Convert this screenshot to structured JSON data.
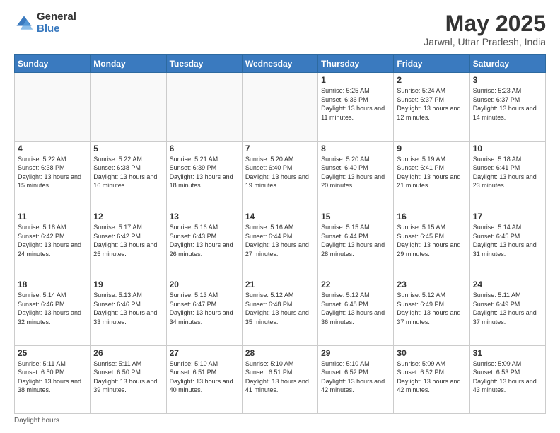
{
  "logo": {
    "general": "General",
    "blue": "Blue"
  },
  "title": "May 2025",
  "location": "Jarwal, Uttar Pradesh, India",
  "days_of_week": [
    "Sunday",
    "Monday",
    "Tuesday",
    "Wednesday",
    "Thursday",
    "Friday",
    "Saturday"
  ],
  "weeks": [
    [
      {
        "day": "",
        "info": ""
      },
      {
        "day": "",
        "info": ""
      },
      {
        "day": "",
        "info": ""
      },
      {
        "day": "",
        "info": ""
      },
      {
        "day": "1",
        "info": "Sunrise: 5:25 AM\nSunset: 6:36 PM\nDaylight: 13 hours and 11 minutes."
      },
      {
        "day": "2",
        "info": "Sunrise: 5:24 AM\nSunset: 6:37 PM\nDaylight: 13 hours and 12 minutes."
      },
      {
        "day": "3",
        "info": "Sunrise: 5:23 AM\nSunset: 6:37 PM\nDaylight: 13 hours and 14 minutes."
      }
    ],
    [
      {
        "day": "4",
        "info": "Sunrise: 5:22 AM\nSunset: 6:38 PM\nDaylight: 13 hours and 15 minutes."
      },
      {
        "day": "5",
        "info": "Sunrise: 5:22 AM\nSunset: 6:38 PM\nDaylight: 13 hours and 16 minutes."
      },
      {
        "day": "6",
        "info": "Sunrise: 5:21 AM\nSunset: 6:39 PM\nDaylight: 13 hours and 18 minutes."
      },
      {
        "day": "7",
        "info": "Sunrise: 5:20 AM\nSunset: 6:40 PM\nDaylight: 13 hours and 19 minutes."
      },
      {
        "day": "8",
        "info": "Sunrise: 5:20 AM\nSunset: 6:40 PM\nDaylight: 13 hours and 20 minutes."
      },
      {
        "day": "9",
        "info": "Sunrise: 5:19 AM\nSunset: 6:41 PM\nDaylight: 13 hours and 21 minutes."
      },
      {
        "day": "10",
        "info": "Sunrise: 5:18 AM\nSunset: 6:41 PM\nDaylight: 13 hours and 23 minutes."
      }
    ],
    [
      {
        "day": "11",
        "info": "Sunrise: 5:18 AM\nSunset: 6:42 PM\nDaylight: 13 hours and 24 minutes."
      },
      {
        "day": "12",
        "info": "Sunrise: 5:17 AM\nSunset: 6:42 PM\nDaylight: 13 hours and 25 minutes."
      },
      {
        "day": "13",
        "info": "Sunrise: 5:16 AM\nSunset: 6:43 PM\nDaylight: 13 hours and 26 minutes."
      },
      {
        "day": "14",
        "info": "Sunrise: 5:16 AM\nSunset: 6:44 PM\nDaylight: 13 hours and 27 minutes."
      },
      {
        "day": "15",
        "info": "Sunrise: 5:15 AM\nSunset: 6:44 PM\nDaylight: 13 hours and 28 minutes."
      },
      {
        "day": "16",
        "info": "Sunrise: 5:15 AM\nSunset: 6:45 PM\nDaylight: 13 hours and 29 minutes."
      },
      {
        "day": "17",
        "info": "Sunrise: 5:14 AM\nSunset: 6:45 PM\nDaylight: 13 hours and 31 minutes."
      }
    ],
    [
      {
        "day": "18",
        "info": "Sunrise: 5:14 AM\nSunset: 6:46 PM\nDaylight: 13 hours and 32 minutes."
      },
      {
        "day": "19",
        "info": "Sunrise: 5:13 AM\nSunset: 6:46 PM\nDaylight: 13 hours and 33 minutes."
      },
      {
        "day": "20",
        "info": "Sunrise: 5:13 AM\nSunset: 6:47 PM\nDaylight: 13 hours and 34 minutes."
      },
      {
        "day": "21",
        "info": "Sunrise: 5:12 AM\nSunset: 6:48 PM\nDaylight: 13 hours and 35 minutes."
      },
      {
        "day": "22",
        "info": "Sunrise: 5:12 AM\nSunset: 6:48 PM\nDaylight: 13 hours and 36 minutes."
      },
      {
        "day": "23",
        "info": "Sunrise: 5:12 AM\nSunset: 6:49 PM\nDaylight: 13 hours and 37 minutes."
      },
      {
        "day": "24",
        "info": "Sunrise: 5:11 AM\nSunset: 6:49 PM\nDaylight: 13 hours and 37 minutes."
      }
    ],
    [
      {
        "day": "25",
        "info": "Sunrise: 5:11 AM\nSunset: 6:50 PM\nDaylight: 13 hours and 38 minutes."
      },
      {
        "day": "26",
        "info": "Sunrise: 5:11 AM\nSunset: 6:50 PM\nDaylight: 13 hours and 39 minutes."
      },
      {
        "day": "27",
        "info": "Sunrise: 5:10 AM\nSunset: 6:51 PM\nDaylight: 13 hours and 40 minutes."
      },
      {
        "day": "28",
        "info": "Sunrise: 5:10 AM\nSunset: 6:51 PM\nDaylight: 13 hours and 41 minutes."
      },
      {
        "day": "29",
        "info": "Sunrise: 5:10 AM\nSunset: 6:52 PM\nDaylight: 13 hours and 42 minutes."
      },
      {
        "day": "30",
        "info": "Sunrise: 5:09 AM\nSunset: 6:52 PM\nDaylight: 13 hours and 42 minutes."
      },
      {
        "day": "31",
        "info": "Sunrise: 5:09 AM\nSunset: 6:53 PM\nDaylight: 13 hours and 43 minutes."
      }
    ]
  ],
  "footer": "Daylight hours"
}
